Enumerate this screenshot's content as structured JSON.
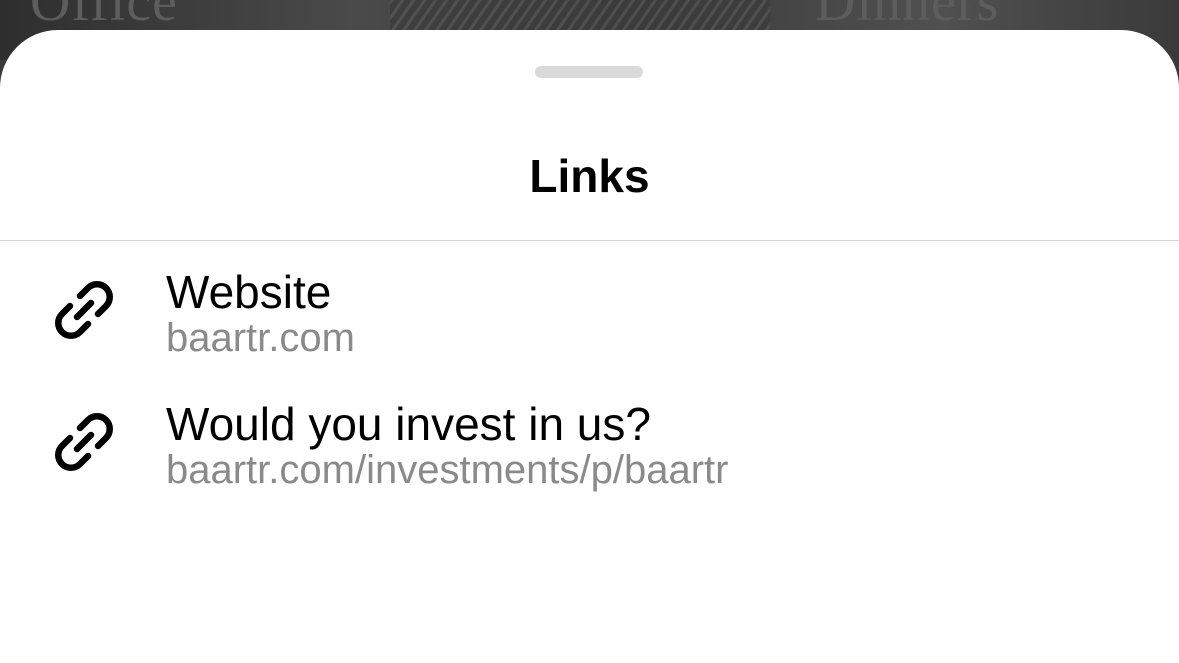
{
  "backdrop": {
    "word_left": "Office",
    "word_right": "Dinners"
  },
  "sheet": {
    "title": "Links",
    "items": [
      {
        "icon": "link-icon",
        "title": "Website",
        "url": "baartr.com"
      },
      {
        "icon": "link-icon",
        "title": "Would you invest in us?",
        "url": "baartr.com/investments/p/baartr"
      }
    ]
  },
  "colors": {
    "sheet_background": "#ffffff",
    "title_text": "#000000",
    "secondary_text": "#8a8a8a",
    "divider": "#d6d6d6",
    "grabber": "#d9d9d9"
  }
}
